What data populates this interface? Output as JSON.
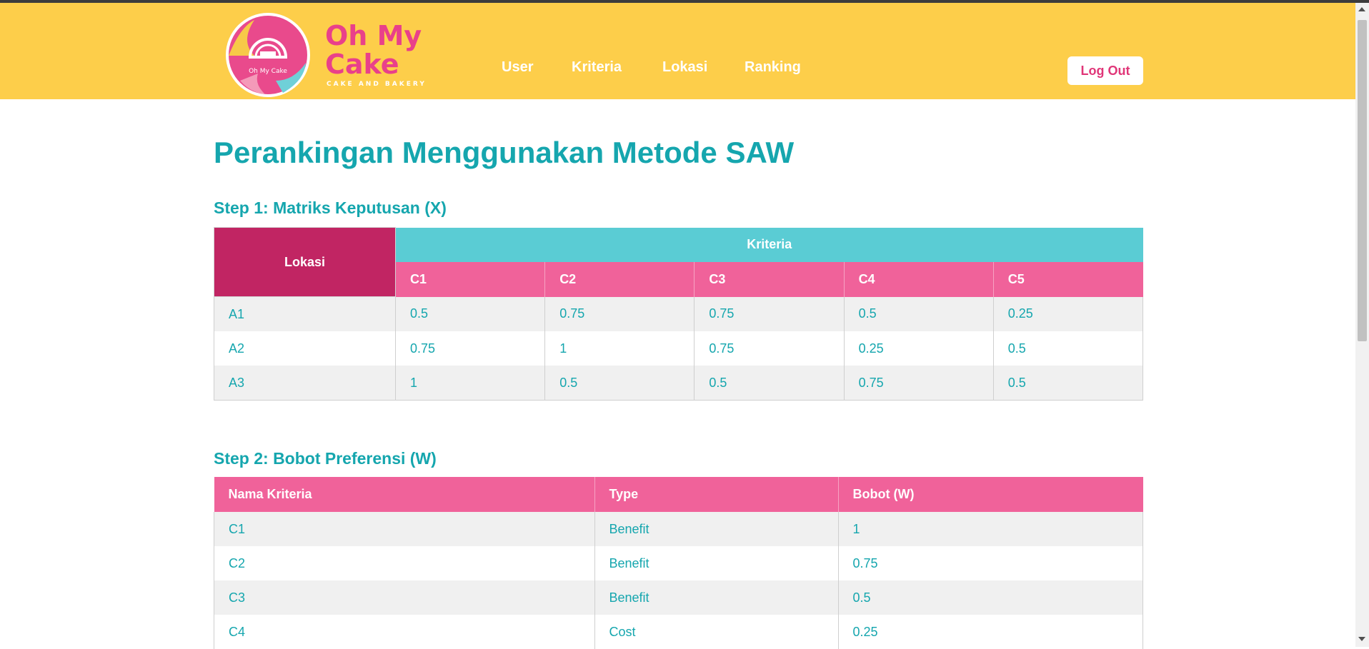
{
  "header": {
    "brand_line1": "Oh My",
    "brand_line2": "Cake",
    "brand_tagline": "CAKE AND BAKERY",
    "logo_text": "Oh My Cake",
    "nav": [
      "User",
      "Kriteria",
      "Lokasi",
      "Ranking"
    ],
    "logout_label": "Log Out",
    "colors": {
      "navbar": "#fdce4a",
      "accent": "#e9408a",
      "teal": "#15a6ae"
    }
  },
  "page": {
    "title": "Perankingan Menggunakan Metode SAW"
  },
  "step1": {
    "title": "Step 1: Matriks Keputusan (X)",
    "lokasi_header": "Lokasi",
    "kriteria_header": "Kriteria",
    "columns": [
      "C1",
      "C2",
      "C3",
      "C4",
      "C5"
    ],
    "rows": [
      {
        "lokasi": "A1",
        "values": [
          "0.5",
          "0.75",
          "0.75",
          "0.5",
          "0.25"
        ]
      },
      {
        "lokasi": "A2",
        "values": [
          "0.75",
          "1",
          "0.75",
          "0.25",
          "0.5"
        ]
      },
      {
        "lokasi": "A3",
        "values": [
          "1",
          "0.5",
          "0.5",
          "0.75",
          "0.5"
        ]
      }
    ]
  },
  "step2": {
    "title": "Step 2: Bobot Preferensi (W)",
    "columns": [
      "Nama Kriteria",
      "Type",
      "Bobot (W)"
    ],
    "rows": [
      [
        "C1",
        "Benefit",
        "1"
      ],
      [
        "C2",
        "Benefit",
        "0.75"
      ],
      [
        "C3",
        "Benefit",
        "0.5"
      ],
      [
        "C4",
        "Cost",
        "0.25"
      ]
    ]
  }
}
